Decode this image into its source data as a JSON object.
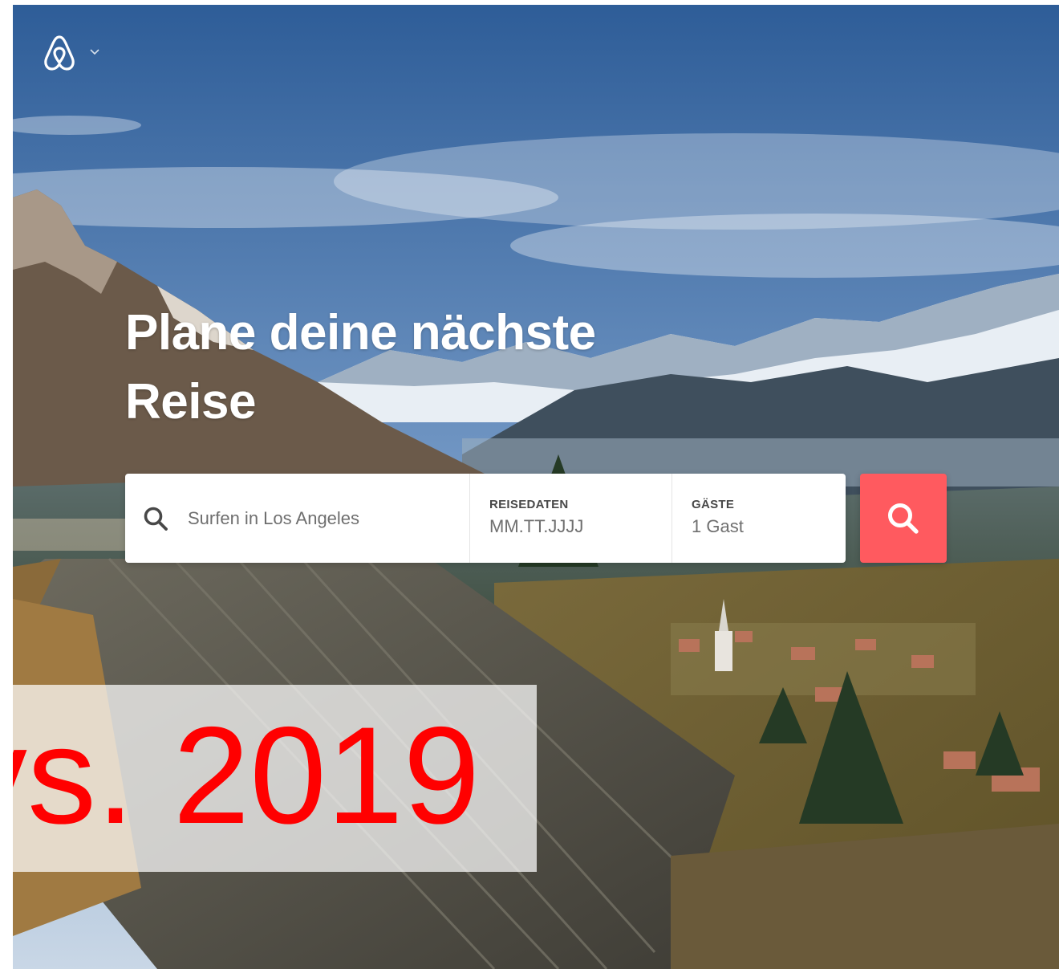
{
  "header": {
    "logo_icon": "airbnb-belo-icon",
    "dropdown_icon": "chevron-down-icon"
  },
  "hero": {
    "headline_line1": "Plane deine nächste",
    "headline_line2": "Reise"
  },
  "search": {
    "icon": "search-icon",
    "where_placeholder": "Surfen in Los Angeles",
    "dates_label": "REISEDATEN",
    "dates_value": "MM.TT.JJJJ",
    "guests_label": "GÄSTE",
    "guests_value": "1 Gast",
    "submit_icon": "search-icon",
    "accent_color": "#FF5A5F"
  },
  "overlay": {
    "text": "vs. 2019",
    "color": "#FF0000"
  }
}
